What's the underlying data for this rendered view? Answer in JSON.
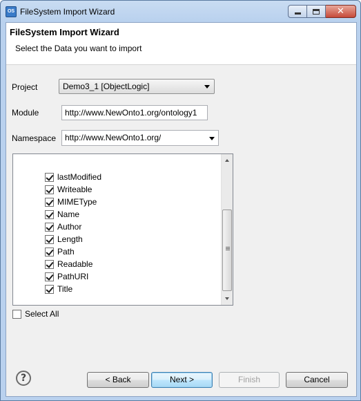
{
  "window": {
    "title": "FileSystem Import Wizard",
    "icon_label": "OS"
  },
  "header": {
    "title": "FileSystem Import Wizard",
    "description": "Select the Data you want to import"
  },
  "form": {
    "project_label": "Project",
    "project_value": "Demo3_1 [ObjectLogic]",
    "module_label": "Module",
    "module_value": "http://www.NewOnto1.org/ontology1",
    "namespace_label": "Namespace",
    "namespace_value": "http://www.NewOnto1.org/"
  },
  "attributes": [
    {
      "label": "lastModified",
      "checked": true
    },
    {
      "label": "Writeable",
      "checked": true
    },
    {
      "label": "MIMEType",
      "checked": true
    },
    {
      "label": "Name",
      "checked": true
    },
    {
      "label": "Author",
      "checked": true
    },
    {
      "label": "Length",
      "checked": true
    },
    {
      "label": "Path",
      "checked": true
    },
    {
      "label": "Readable",
      "checked": true
    },
    {
      "label": "PathURI",
      "checked": true
    },
    {
      "label": "Title",
      "checked": true
    }
  ],
  "select_all": {
    "label": "Select All",
    "checked": false
  },
  "buttons": {
    "help": "?",
    "back": "< Back",
    "next": "Next >",
    "finish": "Finish",
    "cancel": "Cancel"
  },
  "icons": {
    "app": "wizard-app-icon",
    "minimize": "minimize-icon",
    "maximize": "maximize-icon",
    "close": "close-icon",
    "help": "help-icon"
  }
}
